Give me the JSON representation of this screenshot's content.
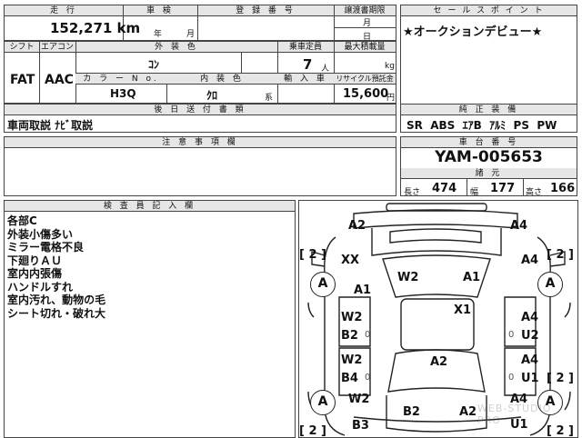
{
  "header": {
    "labels": {
      "mileage": "走 行",
      "inspection": "車 検",
      "registration": "登 録 番 号",
      "transfer_deadline": "譲渡書期限",
      "sales_point": "セ ー ル ス ポ イ ン ト"
    },
    "mileage": "152,271 km",
    "inspection_year": "年",
    "inspection_month": "月",
    "transfer_month": "月",
    "transfer_day": "日"
  },
  "specs": {
    "labels": {
      "shift": "シフト",
      "aircon": "エアコン",
      "exterior_color": "外 装 色",
      "capacity": "乗車定員",
      "max_load": "最大積載量",
      "color_no": "カ ラ ー N o.",
      "interior_color": "内 装 色",
      "import": "輸 入 車",
      "recycle": "リサイクル預託金"
    },
    "shift": "FAT",
    "aircon": "AAC",
    "exterior_color": "ｺﾝ",
    "capacity": "7",
    "capacity_unit": "人",
    "load_unit": "kg",
    "color_no": "H3Q",
    "interior_color": "ｸﾛ",
    "interior_suffix": "系",
    "recycle": "15,600",
    "recycle_unit": "円"
  },
  "sales_point": "★オークションデビュー★",
  "attachments": {
    "label": "後 日 送 付 書 類",
    "value": "車両取説 ﾅﾋﾞ取説"
  },
  "equipment": {
    "label": "純 正 装 備",
    "value": "SR  ABS  ｴｱB  ｱﾙﾐ  PS  PW"
  },
  "notes": {
    "label": "注 意 事 項 欄",
    "value": ""
  },
  "chassis": {
    "label": "車 台 番 号",
    "value": "YAM-005653",
    "dims_label": "諸 元",
    "length_label": "長さ",
    "length": "474",
    "width_label": "幅",
    "width": "177",
    "height_label": "高さ",
    "height": "166"
  },
  "inspector": {
    "label": "検 査 員 記 入 欄",
    "lines": [
      "各部C",
      "外装小傷多い",
      "ミラー電格不良",
      "下廻りＡＵ",
      "室内内張傷",
      "ハンドルすれ",
      "室内汚れ、動物の毛",
      "シート切れ・破れ大"
    ]
  },
  "diagram": {
    "marks": {
      "top_left": "A2",
      "top_right": "A4",
      "bracket_left_1": "[ 2 ]",
      "bracket_right_1": "[ 2 ]",
      "fender_left": "XX",
      "fender_right": "A4",
      "wheel_left_front": "A",
      "wheel_right_front": "A",
      "a1_left": "A1",
      "w2_center": "W2",
      "a1_center": "A1",
      "x1_center": "X1",
      "door_left_front_1": "W2",
      "door_left_front_2": "B2",
      "door_right_front_1": "A4",
      "door_right_front_2": "U2",
      "zero_left_1": "0",
      "zero_right_1": "0",
      "door_left_rear_1": "W2",
      "door_left_rear_2": "B4",
      "door_right_rear_1": "A4",
      "door_right_rear_2": "U1",
      "zero_left_2": "0",
      "zero_right_2": "0",
      "roof_center": "A2",
      "wheel_left_rear": "A",
      "wheel_right_rear": "A",
      "rear_left_1": "W2",
      "rear_right_1": "A4",
      "bracket_right_2": "[ 2 ]",
      "rear_center_left": "B2",
      "rear_center_right": "A2",
      "rear_left_2": "B3",
      "rear_right_2": "U1",
      "bracket_left_2": "[ 2 ]"
    },
    "watermark": "WEB-STUDIO PRO"
  }
}
